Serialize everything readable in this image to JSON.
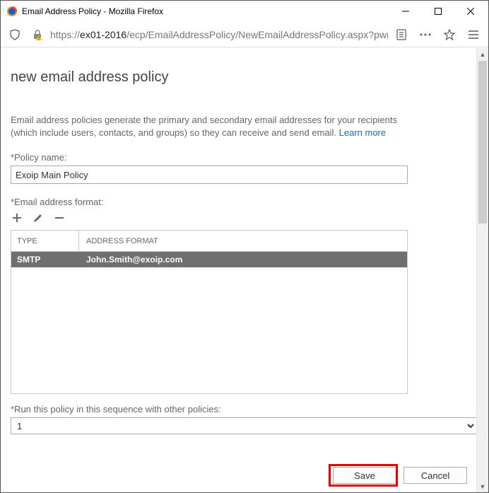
{
  "window": {
    "title": "Email Address Policy - Mozilla Firefox"
  },
  "url": {
    "scheme": "https://",
    "host": "ex01-2016",
    "path": "/ecp/EmailAddressPolicy/NewEmailAddressPolicy.aspx?pwmci"
  },
  "page": {
    "title": "new email address policy",
    "intro": "Email address policies generate the primary and secondary email addresses for your recipients (which include users, contacts, and groups) so they can receive and send email. ",
    "learn_more": "Learn more",
    "policy_name_label": "*Policy name:",
    "policy_name_value": "Exoip Main Policy",
    "format_label": "*Email address format:",
    "grid": {
      "head_type": "TYPE",
      "head_format": "ADDRESS FORMAT",
      "rows": [
        {
          "type": "SMTP",
          "format": "John.Smith@exoip.com"
        }
      ]
    },
    "sequence_label": "*Run this policy in this sequence with other policies:",
    "sequence_value": "1",
    "save": "Save",
    "cancel": "Cancel"
  }
}
